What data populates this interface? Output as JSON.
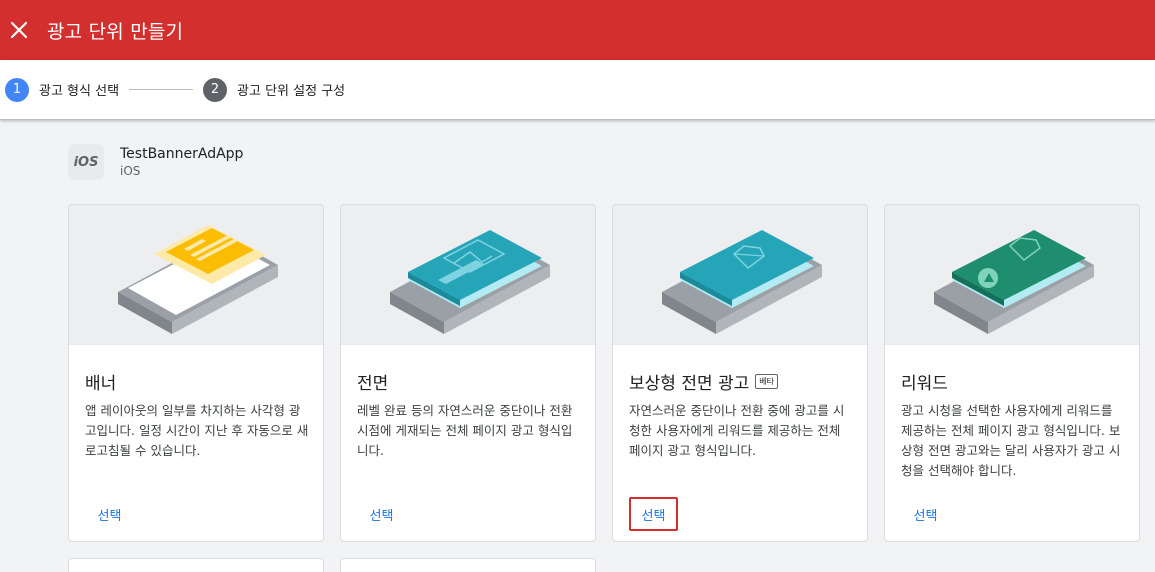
{
  "header": {
    "title": "광고 단위 만들기",
    "close_icon": "close-icon",
    "color": "#d32f2f"
  },
  "stepper": {
    "steps": [
      {
        "number": "1",
        "label": "광고 형식 선택",
        "active": true,
        "color": "#4285f4"
      },
      {
        "number": "2",
        "label": "광고 단위 설정 구성",
        "active": false,
        "color": "#5f6368"
      }
    ]
  },
  "app": {
    "icon_text": "iOS",
    "name": "TestBannerAdApp",
    "platform": "iOS"
  },
  "formats": [
    {
      "title": "배너",
      "description": "앱 레이아웃의 일부를 차지하는 사각형 광고입니다. 일정 시간이 지난 후 자동으로 새로고침될 수 있습니다.",
      "select_label": "선택",
      "highlighted": false
    },
    {
      "title": "전면",
      "description": "레벨 완료 등의 자연스러운 중단이나 전환 시점에 게재되는 전체 페이지 광고 형식입니다.",
      "select_label": "선택",
      "highlighted": false
    },
    {
      "title": "보상형 전면 광고",
      "badge": "베타",
      "description": "자연스러운 중단이나 전환 중에 광고를 시청한 사용자에게 리워드를 제공하는 전체 페이지 광고 형식입니다.",
      "select_label": "선택",
      "highlighted": true
    },
    {
      "title": "리워드",
      "description": "광고 시청을 선택한 사용자에게 리워드를 제공하는 전체 페이지 광고 형식입니다. 보상형 전면 광고와는 달리 사용자가 광고 시청을 선택해야 합니다.",
      "select_label": "선택",
      "highlighted": false
    }
  ],
  "colors": {
    "link": "#1a73e8",
    "background": "#f1f3f4",
    "banner_yellow": "#fbbc04",
    "interstitial_teal": "#26a5b9",
    "rewarded_green": "#1e8e6e"
  }
}
